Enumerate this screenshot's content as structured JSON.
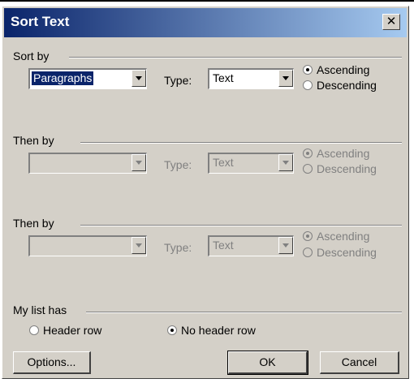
{
  "dialog": {
    "title": "Sort Text",
    "close_glyph": "✕"
  },
  "sort_by": {
    "label": "Sort by",
    "field_value": "Paragraphs",
    "type_label": "Type:",
    "type_value": "Text",
    "ascending_label": "Ascending",
    "descending_label": "Descending",
    "selected_order": "ascending"
  },
  "then_by_1": {
    "label": "Then by",
    "field_value": "",
    "type_label": "Type:",
    "type_value": "Text",
    "ascending_label": "Ascending",
    "descending_label": "Descending",
    "selected_order": "ascending",
    "enabled": false
  },
  "then_by_2": {
    "label": "Then by",
    "field_value": "",
    "type_label": "Type:",
    "type_value": "Text",
    "ascending_label": "Ascending",
    "descending_label": "Descending",
    "selected_order": "ascending",
    "enabled": false
  },
  "list_has": {
    "label": "My list has",
    "header_row_label": "Header row",
    "no_header_row_label": "No header row",
    "selected": "no_header_row"
  },
  "buttons": {
    "options": "Options...",
    "ok": "OK",
    "cancel": "Cancel"
  },
  "icons": {
    "close": "close-icon",
    "dropdown": "chevron-down-icon"
  },
  "colors": {
    "title_start": "#0a246a",
    "title_end": "#a6caf0",
    "face": "#d4d0c8",
    "disabled_text": "#808080"
  }
}
